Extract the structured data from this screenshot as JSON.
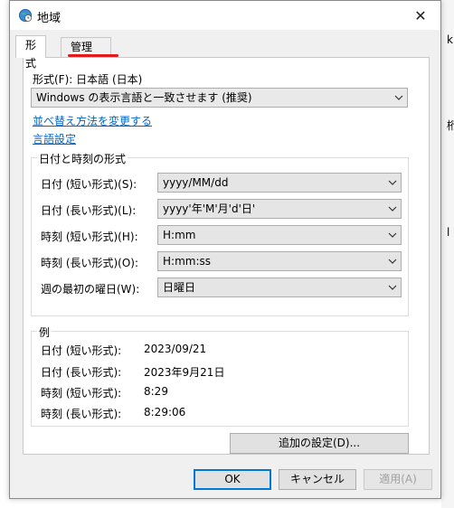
{
  "window": {
    "title": "地域",
    "close_glyph": "✕"
  },
  "tabs": [
    {
      "label": "形式"
    },
    {
      "label": "管理"
    }
  ],
  "format_label": "形式(F): 日本語 (日本)",
  "format_combo": "Windows の表示言語と一致させます (推奨)",
  "links": {
    "sort": "並べ替え方法を変更する",
    "language": "言語設定"
  },
  "datetime_group": {
    "title": "日付と時刻の形式",
    "rows": [
      {
        "label": "日付 (短い形式)(S):",
        "value": "yyyy/MM/dd"
      },
      {
        "label": "日付 (長い形式)(L):",
        "value": "yyyy'年'M'月'd'日'"
      },
      {
        "label": "時刻 (短い形式)(H):",
        "value": "H:mm"
      },
      {
        "label": "時刻 (長い形式)(O):",
        "value": "H:mm:ss"
      },
      {
        "label": "週の最初の曜日(W):",
        "value": "日曜日"
      }
    ]
  },
  "example_group": {
    "title": "例",
    "rows": [
      {
        "label": "日付 (短い形式):",
        "value": "2023/09/21"
      },
      {
        "label": "日付 (長い形式):",
        "value": "2023年9月21日"
      },
      {
        "label": "時刻 (短い形式):",
        "value": "8:29"
      },
      {
        "label": "時刻 (長い形式):",
        "value": "8:29:06"
      }
    ]
  },
  "buttons": {
    "additional": "追加の設定(D)...",
    "ok": "OK",
    "cancel": "キャンセル",
    "apply": "適用(A)"
  },
  "background_glyphs": {
    "a": "k",
    "b": "桁",
    "c": "l"
  },
  "colors": {
    "link": "#0066cc",
    "accent": "#0078d7",
    "tab_marker": "#e01b1b"
  }
}
